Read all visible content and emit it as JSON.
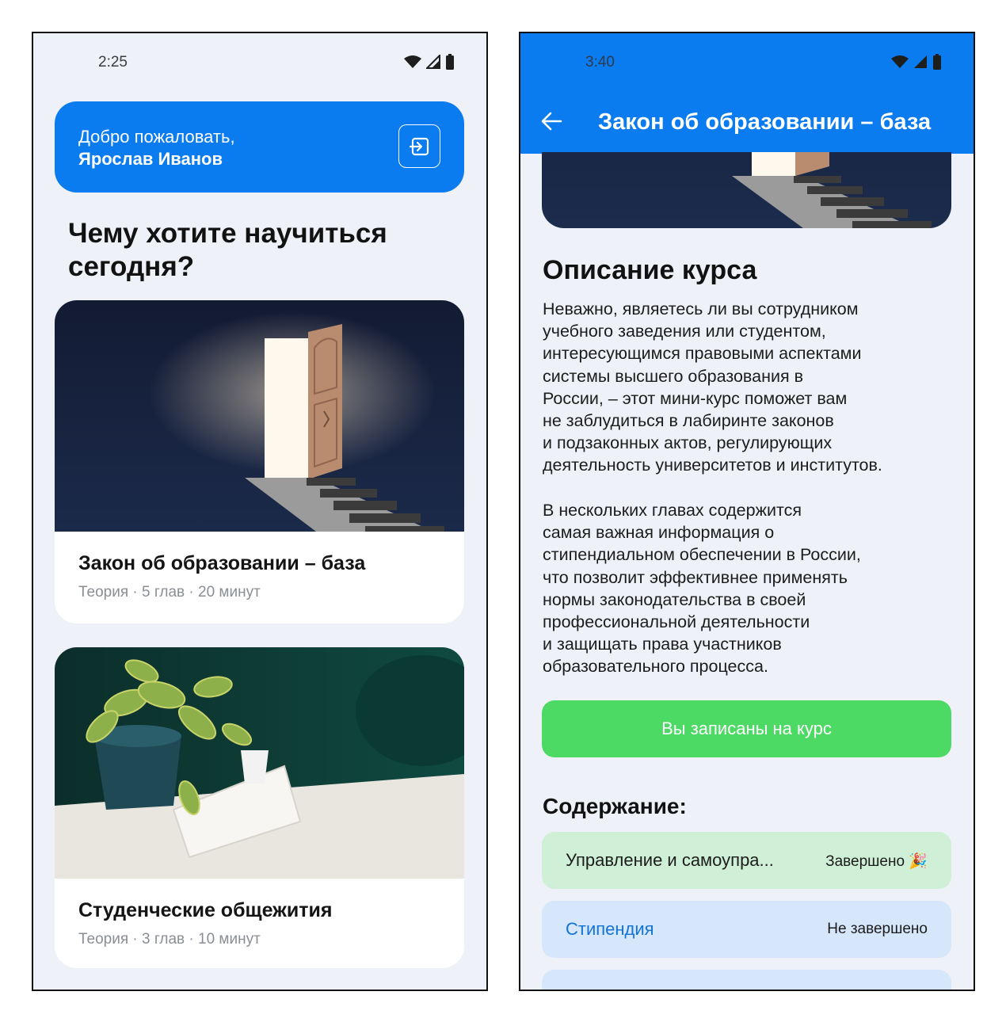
{
  "left": {
    "status": {
      "time": "2:25"
    },
    "welcome": {
      "greeting": "Добро пожаловать,",
      "user_name": "Ярослав Иванов"
    },
    "question": "Чему хотите научиться сегодня?",
    "courses": [
      {
        "title": "Закон об образовании – база",
        "meta": "Теория · 5 глав · 20 минут"
      },
      {
        "title": "Студенческие общежития",
        "meta": "Теория · 3 глав · 10 минут"
      }
    ]
  },
  "right": {
    "status": {
      "time": "3:40"
    },
    "topbar": {
      "title": "Закон об образовании – база"
    },
    "description_heading": "Описание курса",
    "description_p1": "Неважно, являетесь ли вы сотрудником\nучебного заведения или студентом,\nинтересующимся правовыми аспектами\nсистемы высшего образования в\nРоссии, – этот мини-курс поможет вам\nне заблудиться в лабиринте законов\nи подзаконных актов, регулирующих\nдеятельность университетов и институтов.",
    "description_p2": "В нескольких главах содержится\nсамая важная информация о\nстипендиальном обеспечении в России,\nчто позволит эффективнее применять\nнормы законодательства в своей\nпрофессиональной деятельности\nи защищать права участников\nобразовательного процесса.",
    "enrolled_label": "Вы записаны на курс",
    "contents_heading": "Содержание:",
    "chapters": [
      {
        "name": "Управление и самоупра...",
        "state": "Завершено 🎉"
      },
      {
        "name": "Стипендия",
        "state": "Не завершено"
      }
    ]
  },
  "colors": {
    "accent": "#0b7bf0",
    "success": "#4cd964",
    "background": "#eef2f8"
  }
}
